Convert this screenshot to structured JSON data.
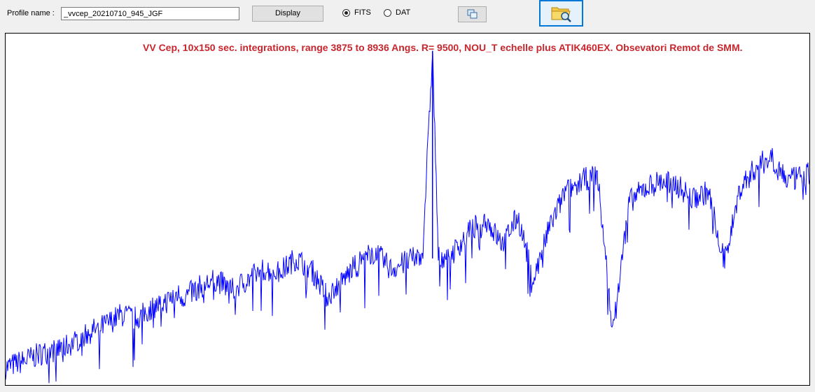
{
  "toolbar": {
    "profile_label": "Profile name :",
    "profile_value": "_vvcep_20210710_945_JGF",
    "display_label": "Display",
    "radio_fits_label": "FITS",
    "radio_dat_label": "DAT",
    "selected_format": "FITS",
    "copy_icon": "copy-window-icon",
    "browse_icon": "folder-search-icon"
  },
  "chart_data": {
    "type": "line",
    "title": "VV Cep, 10x150 sec. integrations, range 3875 to 8936 Angs. R= 9500,  NOU_T echelle plus ATIK460EX.  Obsevatori Remot de SMM.",
    "title_color": "#c8252c",
    "line_color": "#0000ff",
    "xlim": [
      3875,
      8936
    ],
    "ylim": [
      0,
      1
    ],
    "grid": false,
    "x_units": "Angstrom",
    "series": [
      {
        "values_x": [
          3875,
          4000,
          4100,
          4200,
          4300,
          4400,
          4500,
          4600,
          4700,
          4800,
          4900,
          4950,
          5000,
          5100,
          5200,
          5300,
          5400,
          5500,
          5600,
          5700,
          5800,
          5900,
          6000,
          6100,
          6200,
          6300,
          6400,
          6500,
          6563,
          6600,
          6700,
          6800,
          6900,
          7000,
          7100,
          7200,
          7300,
          7400,
          7500,
          7600,
          7700,
          7800,
          7900,
          8000,
          8100,
          8200,
          8300,
          8400,
          8500,
          8600,
          8700,
          8800,
          8936
        ],
        "values_y": [
          0.05,
          0.07,
          0.09,
          0.1,
          0.12,
          0.15,
          0.17,
          0.2,
          0.19,
          0.22,
          0.24,
          0.26,
          0.25,
          0.28,
          0.3,
          0.27,
          0.3,
          0.33,
          0.32,
          0.36,
          0.33,
          0.25,
          0.3,
          0.35,
          0.38,
          0.33,
          0.35,
          0.37,
          0.95,
          0.36,
          0.38,
          0.44,
          0.47,
          0.4,
          0.48,
          0.3,
          0.45,
          0.55,
          0.58,
          0.6,
          0.15,
          0.52,
          0.56,
          0.58,
          0.57,
          0.53,
          0.55,
          0.35,
          0.56,
          0.62,
          0.65,
          0.58,
          0.6
        ]
      }
    ]
  }
}
